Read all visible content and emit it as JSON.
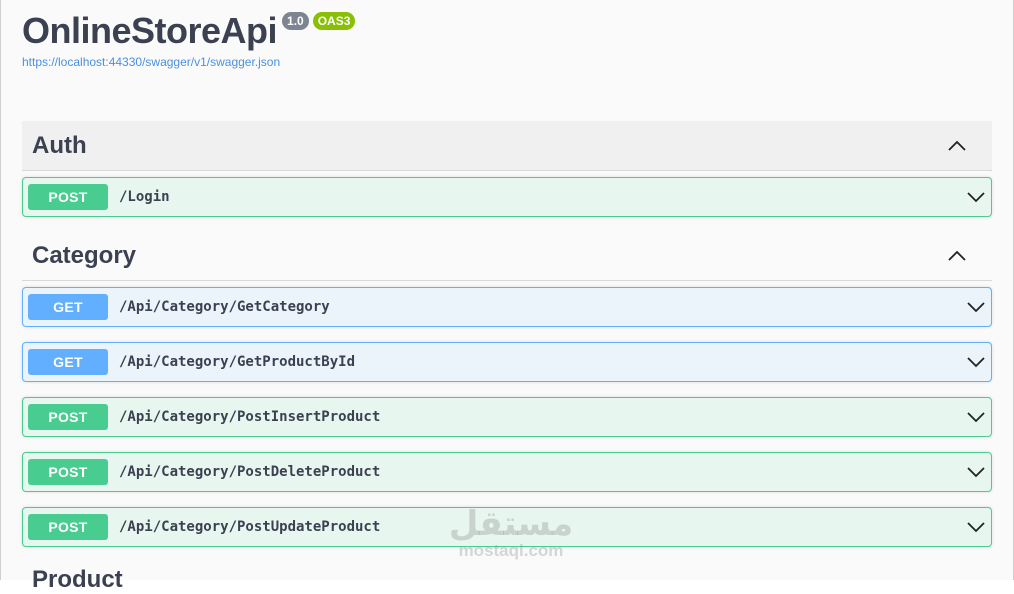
{
  "info": {
    "title": "OnlineStoreApi",
    "version_badge": "1.0",
    "oas_badge": "OAS3",
    "spec_url": "https://localhost:44330/swagger/v1/swagger.json"
  },
  "tags": [
    {
      "name": "Auth",
      "operations": [
        {
          "method": "POST",
          "path": "/Login"
        }
      ]
    },
    {
      "name": "Category",
      "operations": [
        {
          "method": "GET",
          "path": "/Api/Category/GetCategory"
        },
        {
          "method": "GET",
          "path": "/Api/Category/GetProductById"
        },
        {
          "method": "POST",
          "path": "/Api/Category/PostInsertProduct"
        },
        {
          "method": "POST",
          "path": "/Api/Category/PostDeleteProduct"
        },
        {
          "method": "POST",
          "path": "/Api/Category/PostUpdateProduct"
        }
      ]
    },
    {
      "name": "Product"
    }
  ],
  "watermark": {
    "arabic": "مستقل",
    "latin": "mostaql.com"
  },
  "icons": {
    "collapse": "chevron-up-icon",
    "expand": "chevron-down-icon"
  },
  "colors": {
    "post": "#49cc90",
    "get": "#61affe",
    "title": "#3b4151",
    "link": "#4990e2",
    "oas_badge": "#89bf04"
  }
}
